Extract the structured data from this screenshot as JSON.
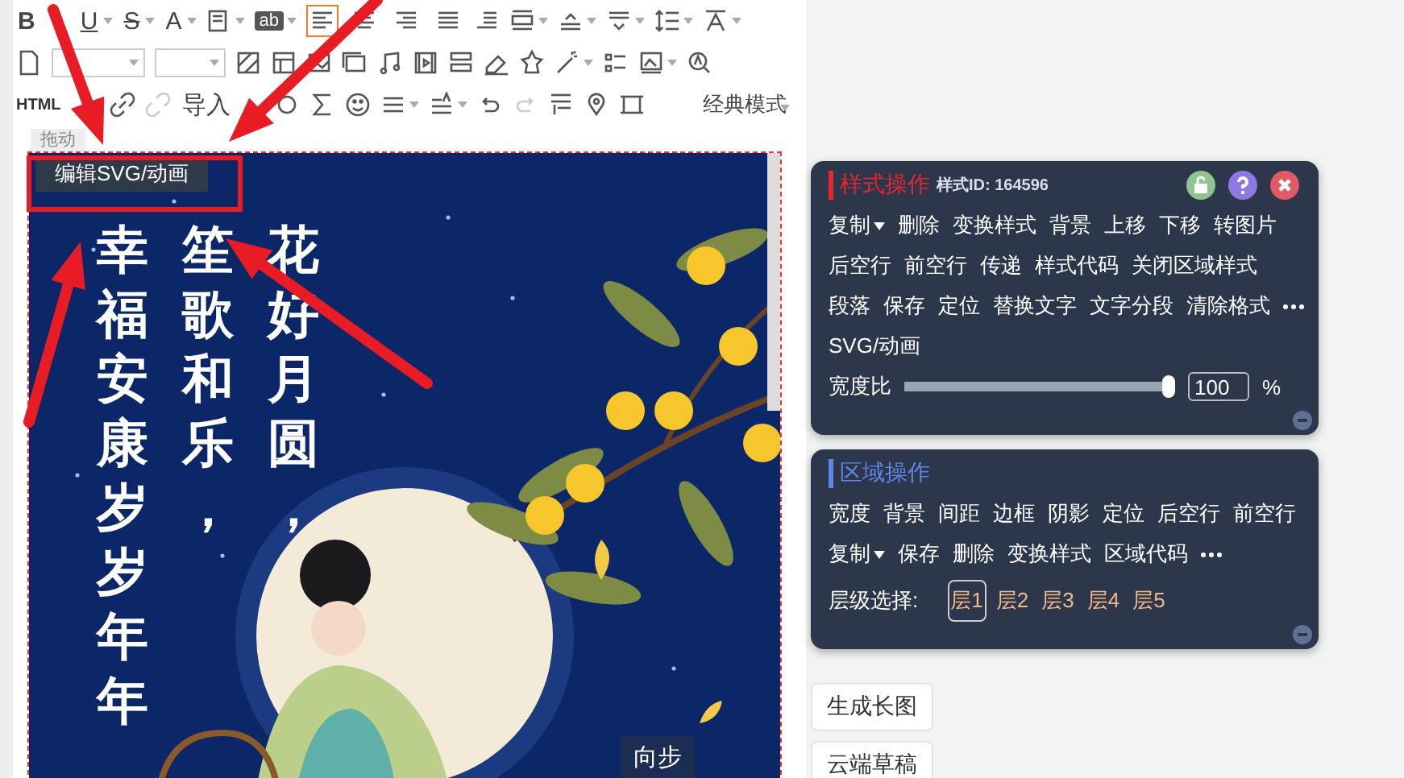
{
  "toolbar": {
    "format_labels": [
      "B",
      "U",
      "S",
      "A"
    ],
    "highlight_label": "ab",
    "align_buttons": [
      {
        "selected": true
      },
      {
        "selected": false
      },
      {
        "selected": false
      },
      {
        "selected": false
      }
    ],
    "html_label": "HTML",
    "import_label": "导入",
    "mode_menu": "经典模式"
  },
  "canvas": {
    "drag_tab": "拖动",
    "edit_svg_button": "编辑SVG/动画",
    "poem_columns": [
      "幸福安康岁岁年年",
      "笙歌和乐，",
      "花好月圆，"
    ],
    "sync_button": "向步"
  },
  "style_panel": {
    "title": "样式操作",
    "style_id": "样式ID: 164596",
    "rows": [
      {
        "items": [
          {
            "label": "复制",
            "kind": "dropdown"
          },
          {
            "label": "删除",
            "kind": "action"
          },
          {
            "label": "变换样式",
            "kind": "action"
          },
          {
            "label": "背景",
            "kind": "action"
          },
          {
            "label": "上移",
            "kind": "action"
          },
          {
            "label": "下移",
            "kind": "action"
          },
          {
            "label": "转图片",
            "kind": "action"
          }
        ]
      },
      {
        "items": [
          {
            "label": "后空行",
            "kind": "action"
          },
          {
            "label": "前空行",
            "kind": "action"
          },
          {
            "label": "传递",
            "kind": "action"
          },
          {
            "label": "样式代码",
            "kind": "action"
          },
          {
            "label": "关闭区域样式",
            "kind": "action"
          }
        ]
      },
      {
        "items": [
          {
            "label": "段落",
            "kind": "action"
          },
          {
            "label": "保存",
            "kind": "action"
          },
          {
            "label": "定位",
            "kind": "action"
          },
          {
            "label": "替换文字",
            "kind": "action"
          },
          {
            "label": "文字分段",
            "kind": "action"
          },
          {
            "label": "清除格式",
            "kind": "action"
          },
          {
            "kind": "more"
          }
        ]
      },
      {
        "items": [
          {
            "label": "SVG/动画",
            "kind": "action"
          }
        ]
      }
    ],
    "slider": {
      "label": "宽度比",
      "level": 1,
      "value": "100",
      "unit": "%"
    }
  },
  "region_panel": {
    "title": "区域操作",
    "rows": [
      {
        "items": [
          {
            "label": "宽度",
            "kind": "action"
          },
          {
            "label": "背景",
            "kind": "action"
          },
          {
            "label": "间距",
            "kind": "action"
          },
          {
            "label": "边框",
            "kind": "action"
          },
          {
            "label": "阴影",
            "kind": "action"
          },
          {
            "label": "定位",
            "kind": "action"
          },
          {
            "label": "后空行",
            "kind": "action"
          },
          {
            "label": "前空行",
            "kind": "action"
          }
        ]
      },
      {
        "items": [
          {
            "label": "复制",
            "kind": "dropdown"
          },
          {
            "label": "保存",
            "kind": "action"
          },
          {
            "label": "删除",
            "kind": "action"
          },
          {
            "label": "变换样式",
            "kind": "action"
          },
          {
            "label": "区域代码",
            "kind": "action"
          },
          {
            "kind": "more"
          }
        ]
      }
    ],
    "layer_label": "层级选择:",
    "layers": [
      {
        "label": "层1",
        "selected": true
      },
      {
        "label": "层2",
        "selected": false
      },
      {
        "label": "层3",
        "selected": false
      },
      {
        "label": "层4",
        "selected": false
      },
      {
        "label": "层5",
        "selected": false
      }
    ]
  },
  "side_buttons": [
    "生成长图",
    "云端草稿"
  ]
}
